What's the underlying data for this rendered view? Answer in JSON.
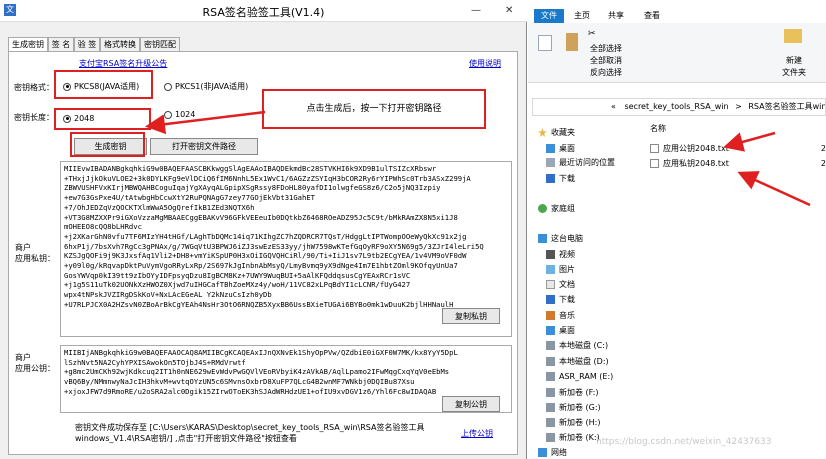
{
  "window": {
    "title": "RSA签名验签工具(V1.4)",
    "minimize": "—",
    "close": "✕"
  },
  "tabs": [
    "生成密钥",
    "签 名",
    "验 签",
    "格式转换",
    "密钥匹配"
  ],
  "links": {
    "top": "支付宝RSA签名升级公告",
    "help": "使用说明",
    "upload": "上传公钥"
  },
  "key_format": {
    "label": "密钥格式：",
    "options": [
      "PKCS8(JAVA适用)",
      "PKCS1(非JAVA适用)"
    ],
    "selected": 0
  },
  "key_length": {
    "label": "密钥长度：",
    "options": [
      "2048",
      "1024"
    ],
    "selected": 0
  },
  "buttons": {
    "generate": "生成密钥",
    "open_path": "打开密钥文件路径",
    "copy_private": "复制私钥",
    "copy_public": "复制公钥"
  },
  "callout": "点击生成后，按一下打开密钥路径",
  "private_key": {
    "label_line1": "商户",
    "label_line2": "应用私钥：",
    "value": "MIIEvwIBADANBgkqhkiG9w0BAQEFAASCBKkwggSlAgEAAoIBAQDEkmdBc28STVKHI6k9XD9B1ulTSIZcXRbswr\n+THxjJjkOkuVLOE2+3k0DYLKFg9eVlDCiQ6fIM6NnhL5Ex1WvC1/6AGZzZSYIqH3bCOR2Ry6rYIPWhSc0Trb3ASxZ299jA\nZBWVUSHFVxKIrjMBWQAHBCoguIqajYgXAyqALGpipXSgRssy8FDoHL80yafDI1olwgfeGS8z6/C2o5jNQ3Izpiy\n+ew7G3GsPxe4U/tAtwbgHbCcwXtY2RuPQNAgG7zey77GOjEkVbt31GahET\n+7/OhJEDZqVzQOCKTXlmWwA5OgQrefIkB1ZEd3NQTX6h\n+VT3G8MZXXPr9iGXoVzzaMgMBAAECggEBAKvV96GFkVEEeuIb0DQtkbZ6468ROeADZ95Jc5C9t/bMkRAmZX8N5xi1J8\nmOHEEO8cQQ8bLHRdvc\n+j2XKarGhN0vfu7TF6MIzYH4tHGf/LAghTbDQMc14iq71KIhgZC7hZQDRCR7TQsT/HdggLtIPTWompOOeWyQkXc91x2jg\n6hxP1j/7bsXvh7RgCc3gPNAx/g/7WGqVtU3BPWJ6iZJ3swEzES33yy/jhW7598wKTefGqOyRF9oXY5N69g5/3ZJrI4leLri5Q\nKZSJgQOFi9j9K3JxsfAq1Vli2+DH8+vmYiKSpUP0H3xOiIGQVQHCiRl/90/Ti+IiJ1sv7L9tb2ECgYEA/1v4VM9oVF0dW\n+y09l0g/kRqvapDktPuVymVgoRRyLxRp/2S697kJgInbnAbMsyQ/LmyBvmq9yX9dNge4Im7E1hbtZOml9KOfqyUnUa7\nGosYWVqp0kI39tt9zIbOYyIDFpsyqDzu8IgBCM8Kz+7UWY9WuqBUI+5aAlKFQddqsusCgYEAxRCr1sVC\n+j1g5S11uTk02UONkXzHWOZ0Xjwd7uIHGCafTBhZoeMXz4y/woH/11VC82xLPqBdYI1cLCNR/fUyG427\nwpx4tNPskJVZIRgDSkKoV+NxLAcEGeAL Y2kNzuCsIzh0yDb\n+U7RLPJCX0A2HZsvN0ZBoArBkCgYEAh4NsHr3OtO6RNQZB5XyxBB6UssBXieTUGAi6BYBo0mk1wDuuK2bjlHHNaulH"
  },
  "public_key": {
    "label_line1": "商户",
    "label_line2": "应用公钥：",
    "value": "MIIBIjANBgkqhkiG9w0BAQEFAAOCAQ8AMIIBCgKCAQEAxIJnQXNvEk1ShyOpPVw/QZdbiE0iGXF0W7MK/kx8YyY5DpL\nlSzhNvt5NA2CyhYPXISAwokOn5TOjbJ4S+RMdVrwtf\n+g8mc2UmCKh92wjKdkcuq2IT1h0nNE629wEvWdvPwGQVlVEoRVbyiK4zAVkAB/AqlLpamo2IFwMqgCxqYqV0eEbMs\nvBQ6By/NMmnwyNaJcIH3hkvM+wvtqOYzUN5c6SMvnsOxbrD8XuFP7QLcG4B2wnMF7WNkbj0DQIBu87Xsu\n+xjoxJFW7d9RmoRE/u2oSRA2alc0Dgik15ZIrwOToEK3hSJAdWRHdzUE1+ofIU9xvDGV1z6/Yhl6Fc8wIDAQAB"
  },
  "footer": {
    "line1": "密钥文件成功保存至 [C:\\Users\\KARAS\\Desktop\\secret_key_tools_RSA_win\\RSA签名验签工具",
    "line2": "windows_V1.4\\RSA密钥/] ,点击\"打开密钥文件路径\"按钮查看"
  },
  "explorer": {
    "ribbon_tabs": [
      "文件",
      "主页",
      "共享",
      "查看"
    ],
    "ribbon_items": [
      "全部选择",
      "全部取消",
      "反向选择",
      "新建",
      "文件夹"
    ],
    "address": [
      "«",
      "secret_key_tools_RSA_win",
      ">",
      "RSA签名验签工具windows"
    ],
    "column_header": "名称",
    "nav_items": [
      {
        "label": "收藏夹",
        "icon": "star-icon"
      },
      {
        "label": "桌面",
        "icon": "desktop-icon"
      },
      {
        "label": "最近访问的位置",
        "icon": "recent-icon"
      },
      {
        "label": "下载",
        "icon": "download-icon"
      },
      {
        "label": "家庭组",
        "icon": "homegroup-icon"
      },
      {
        "label": "这台电脑",
        "icon": "computer-icon"
      },
      {
        "label": "视频",
        "icon": "video-icon"
      },
      {
        "label": "图片",
        "icon": "picture-icon"
      },
      {
        "label": "文档",
        "icon": "document-icon"
      },
      {
        "label": "下载",
        "icon": "download-icon"
      },
      {
        "label": "音乐",
        "icon": "music-icon"
      },
      {
        "label": "桌面",
        "icon": "desktop-icon"
      },
      {
        "label": "本地磁盘 (C:)",
        "icon": "drive-icon"
      },
      {
        "label": "本地磁盘 (D:)",
        "icon": "drive-icon"
      },
      {
        "label": "ASR_RAM (E:)",
        "icon": "drive-icon"
      },
      {
        "label": "新加卷 (F:)",
        "icon": "drive-icon"
      },
      {
        "label": "新加卷 (G:)",
        "icon": "drive-icon"
      },
      {
        "label": "新加卷 (H:)",
        "icon": "drive-icon"
      },
      {
        "label": "新加卷 (K:)",
        "icon": "drive-icon"
      },
      {
        "label": "网络",
        "icon": "network-icon"
      }
    ],
    "files": [
      {
        "name": "应用公钥2048.txt",
        "date": "2"
      },
      {
        "name": "应用私钥2048.txt",
        "date": "2"
      }
    ]
  },
  "watermark": "https://blog.csdn.net/weixin_42437633",
  "colors": {
    "annotation_red": "#e02020",
    "link_blue": "#0000cc",
    "ribbon_file": "#1979ca"
  }
}
